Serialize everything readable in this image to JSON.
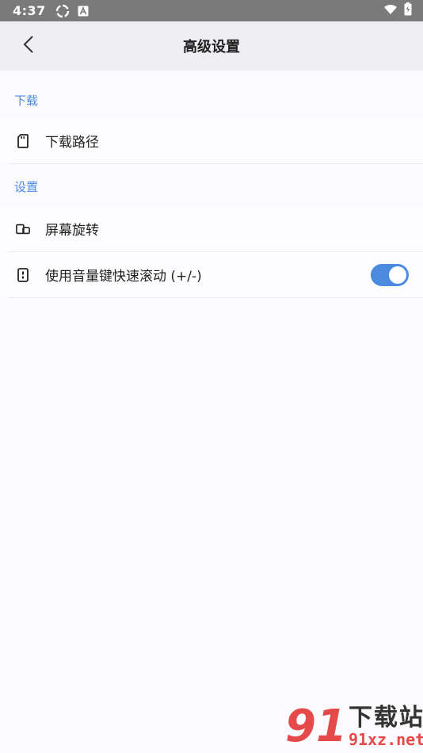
{
  "status_bar": {
    "time": "4:37",
    "icons": [
      "sync-icon",
      "a-badge-icon",
      "wifi-icon",
      "battery-icon"
    ]
  },
  "app_bar": {
    "title": "高级设置",
    "back_icon": "chevron-left-icon"
  },
  "sections": [
    {
      "header": "下载",
      "items": [
        {
          "label": "下载路径",
          "icon": "sd-card-icon"
        }
      ]
    },
    {
      "header": "设置",
      "items": [
        {
          "label": "屏幕旋转",
          "icon": "screen-rotation-icon"
        },
        {
          "label": "使用音量键快速滚动 (+/-)",
          "icon": "volume-keys-icon",
          "toggle_on": true
        }
      ]
    }
  ],
  "watermark": {
    "number": "91",
    "text": "下载站",
    "domain": "91xz.net"
  },
  "colors": {
    "accent": "#4a8be0",
    "status_bar": "#7a7a7a",
    "app_bar": "#efeff3",
    "background": "#fbfbfe",
    "watermark_red": "#e54a4a"
  }
}
